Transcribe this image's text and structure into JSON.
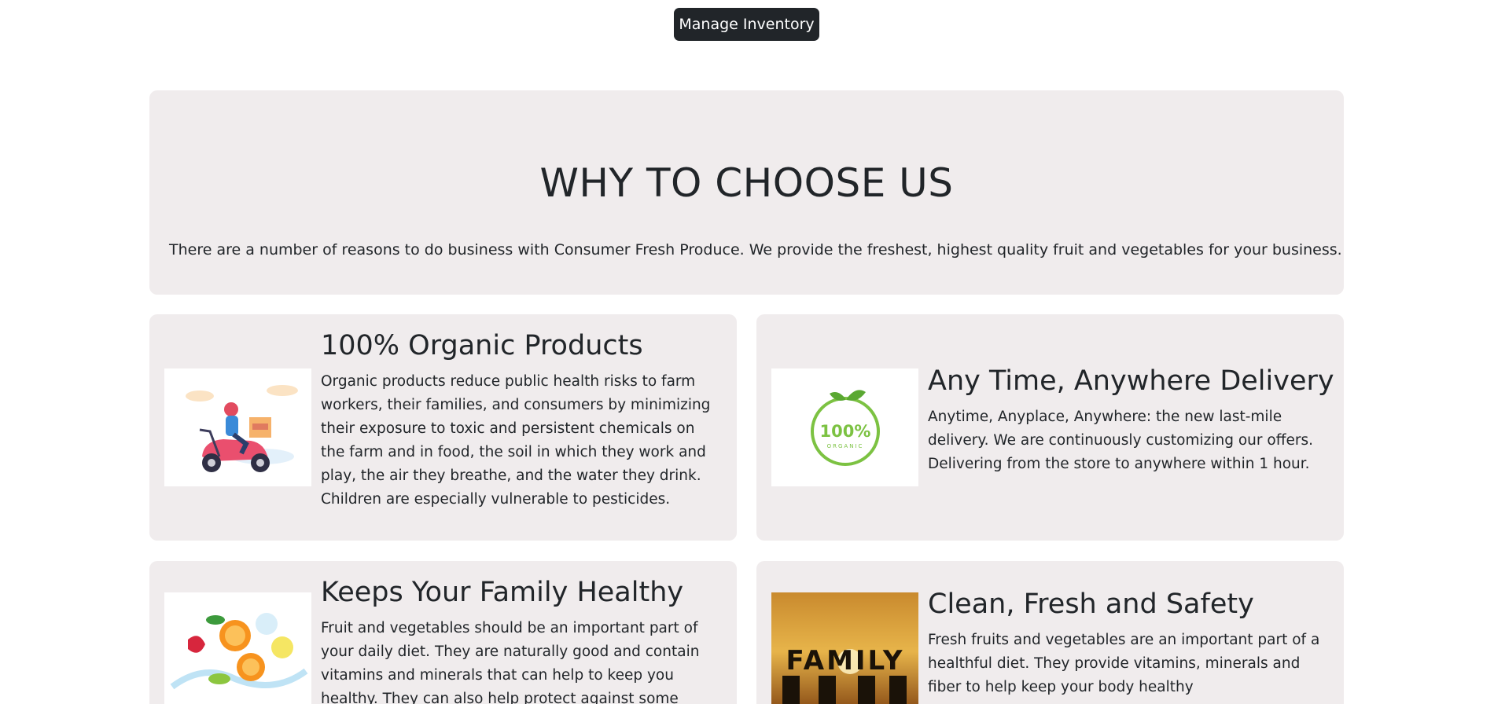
{
  "toolbar": {
    "manage_inventory_label": "Manage Inventory"
  },
  "why_section": {
    "title": "WHY TO CHOOSE US",
    "description": "There are a number of reasons to do business with Consumer Fresh Produce. We provide the freshest, highest quality fruit and vegetables for your business."
  },
  "features": [
    {
      "title": "100% Organic Products",
      "text": "Organic products reduce public health risks to farm workers, their families, and consumers by minimizing their exposure to toxic and persistent chemicals on the farm and in food, the soil in which they work and play, the air they breathe, and the water they drink. Children are especially vulnerable to pesticides.",
      "image": "delivery-scooter-illustration"
    },
    {
      "title": "Any Time, Anywhere Delivery",
      "text": "Anytime, Anyplace, Anywhere: the new last-mile delivery. We are continuously customizing our offers. Delivering from the store to anywhere within 1 hour.",
      "image": "organic-badge",
      "badge_text": "100%",
      "badge_subtext": "ORGANIC"
    },
    {
      "title": "Keeps Your Family Healthy",
      "text": "Fruit and vegetables should be an important part of your daily diet. They are naturally good and contain vitamins and minerals that can help to keep you healthy. They can also help protect against some diseases.",
      "image": "fruit-splash-photo"
    },
    {
      "title": "Clean, Fresh and Safety",
      "text": "Fresh fruits and vegetables are an important part of a healthful diet. They provide vitamins, minerals and fiber to help keep your body healthy",
      "image": "family-sunset-photo",
      "photo_text": "FAMILY"
    }
  ],
  "colors": {
    "card_bg": "#f0eced",
    "button_bg": "#212529",
    "text": "#212529",
    "organic_green": "#7cc242"
  }
}
